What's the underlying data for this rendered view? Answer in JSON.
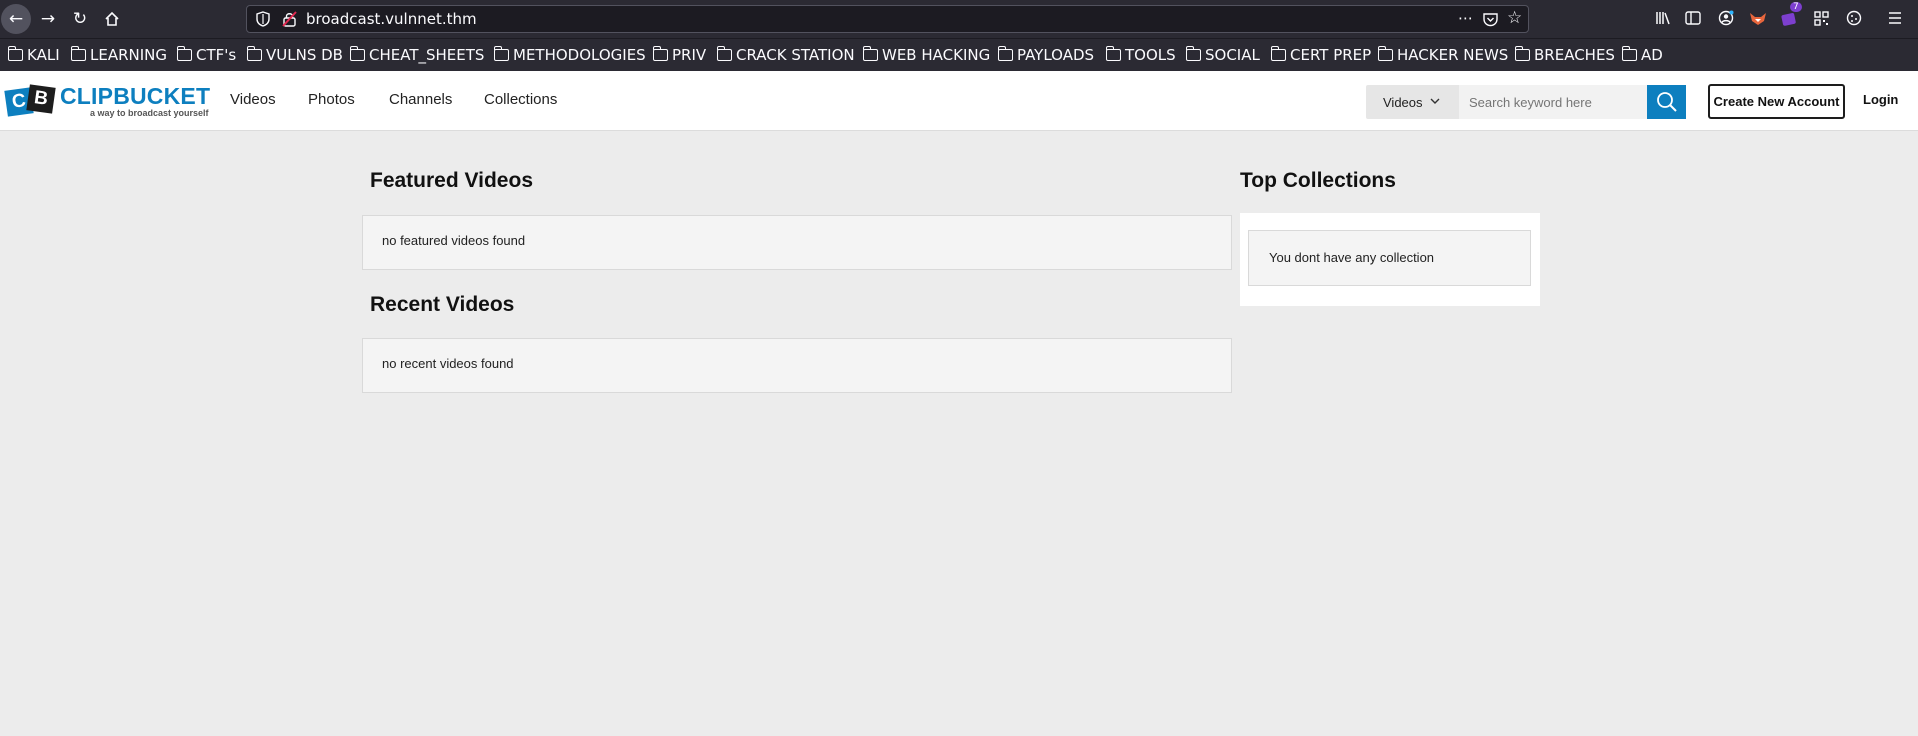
{
  "browser": {
    "url": "broadcast.vulnnet.thm",
    "extension_badge": "7",
    "bookmarks": [
      "KALI",
      "LEARNING",
      "CTF's",
      "VULNS DB",
      "CHEAT_SHEETS",
      "METHODOLOGIES",
      "PRIV",
      "CRACK STATION",
      "WEB HACKING",
      "PAYLOADS",
      "TOOLS",
      "SOCIAL",
      "CERT PREP",
      "HACKER NEWS",
      "BREACHES",
      "AD"
    ]
  },
  "site": {
    "logo_text": "CLIPBUCKET",
    "logo_letters": [
      "C",
      "B"
    ],
    "tagline": "a way to broadcast yourself",
    "nav": [
      "Videos",
      "Photos",
      "Channels",
      "Collections"
    ],
    "search": {
      "type_selected": "Videos",
      "placeholder": "Search keyword here"
    },
    "create_account_label": "Create New Account",
    "login_label": "Login",
    "brand_color": "#0d7fbf"
  },
  "main": {
    "featured_title": "Featured Videos",
    "featured_empty": "no featured videos found",
    "recent_title": "Recent Videos",
    "recent_empty": "no recent videos found"
  },
  "sidebar": {
    "top_collections_title": "Top Collections",
    "empty_message": "You dont have any collection"
  }
}
